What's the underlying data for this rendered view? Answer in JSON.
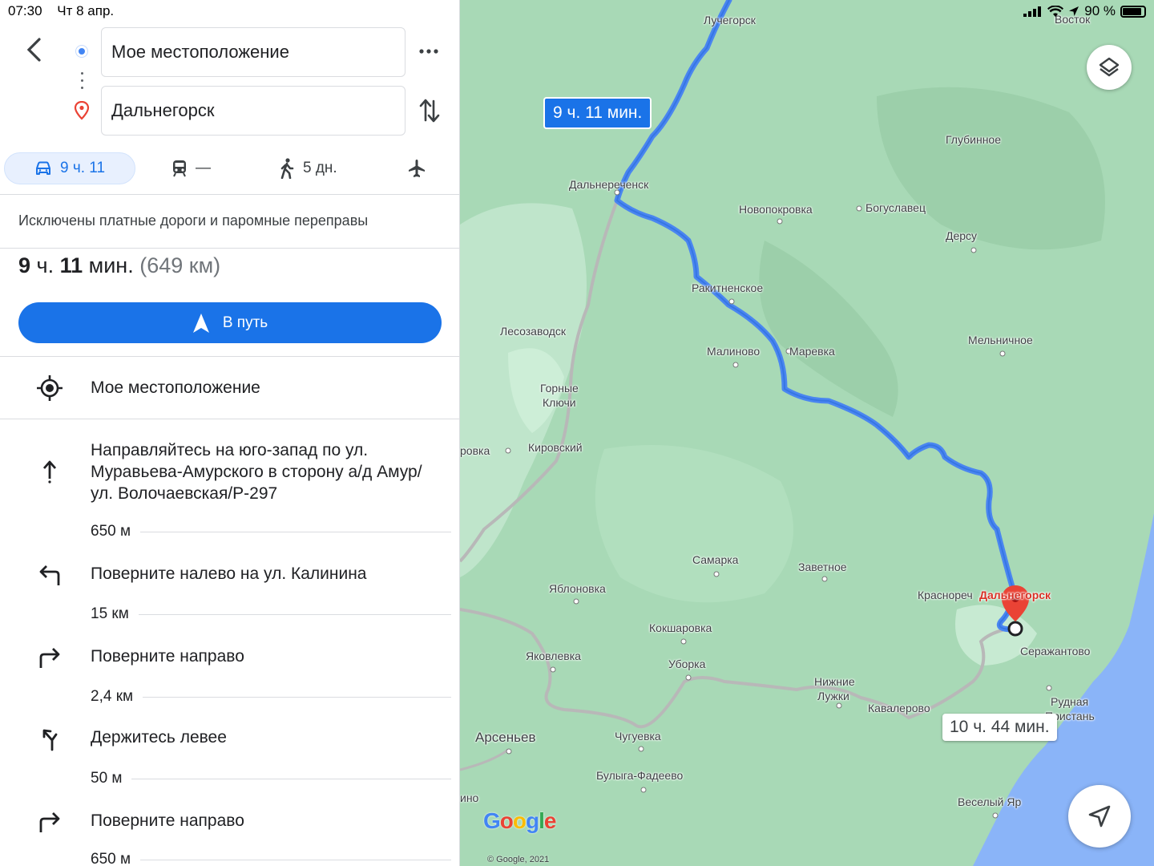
{
  "status_bar": {
    "time": "07:30",
    "date": "Чт 8 апр.",
    "battery": "90 %"
  },
  "directions": {
    "origin": "Мое местоположение",
    "destination": "Дальнегорск",
    "modes": {
      "car": "9 ч. 11",
      "transit": "—",
      "walk": "5 дн."
    },
    "notice": "Исключены платные дороги и паромные переправы",
    "summary": {
      "h": "9",
      "h_unit": " ч. ",
      "m": "11",
      "m_unit": " мин. ",
      "distance": "(649 км)"
    },
    "go_label": "В путь",
    "start_label": "Мое местоположение",
    "steps": [
      {
        "text": "Направляйтесь на юго-запад по ул. Муравьева-Амурского в сторону а/д Амур/ул. Волочаевская/Р-297",
        "distance": "650 м"
      },
      {
        "text": "Поверните налево на ул. Калинина",
        "distance": "15 км"
      },
      {
        "text": "Поверните направо",
        "distance": "2,4 км"
      },
      {
        "text": "Держитесь левее",
        "distance": "50 м"
      },
      {
        "text": "Поверните направо",
        "distance": "650 м"
      }
    ]
  },
  "map": {
    "route_main_label": "9 ч. 11 мин.",
    "route_alt_label": "10 ч. 44 мин.",
    "places": {
      "luchegorsk": "Лучегорск",
      "vostok": "Восток",
      "glubinnoe": "Глубинное",
      "dalnerechensk": "Дальнереченск",
      "novopokrovka": "Новопокровка",
      "bogoslavets": "Богуславец",
      "dersu": "Дерсу",
      "rakitnenskoe": "Ракитненское",
      "lesozavodsk": "Лесозаводск",
      "malinovo": "Малиново",
      "marevka": "Маревка",
      "melnichnoe": "Мельничное",
      "gornye1": "Горные",
      "gornye2": "Ключи",
      "kirovsky": "Кировский",
      "dorovka": "ровка",
      "samarka": "Самарка",
      "zavetnoe": "Заветное",
      "yablonovka": "Яблоновка",
      "krasnorechensky": "Краснореч",
      "dalnegorsk": "Дальнегорск",
      "koksharovka": "Кокшаровка",
      "serzhantovo": "Серажантово",
      "yakovlevka": "Яковлевка",
      "uborka": "Уборка",
      "nizhnie1": "Нижние",
      "nizhnie2": "Лужки",
      "kavalerovo": "Кавалерово",
      "rudnaya1": "Рудная",
      "rudnaya2": "Пристань",
      "arsenyev": "Арсеньев",
      "chuguevka": "Чугуевка",
      "buluga": "Булыга-Фадеево",
      "vesely": "Веселый Яр",
      "ino": "ино"
    },
    "google_logo": "Google",
    "copyright": "© Google, 2021"
  },
  "colors": {
    "accent": "#1a73e8",
    "map_green": "#9fd5b0",
    "sea": "#8ab4f8",
    "route": "#4a86f0"
  }
}
